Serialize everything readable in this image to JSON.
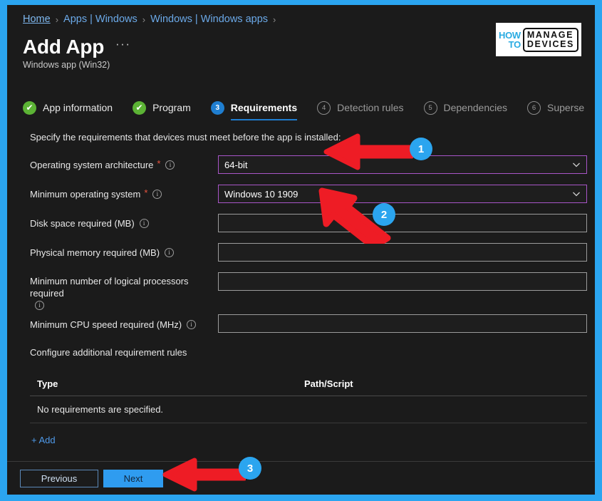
{
  "frame": {
    "accent_color": "#2ba5f0",
    "panel_bg": "#1b1b1b"
  },
  "breadcrumb": {
    "items": [
      {
        "label": "Home"
      },
      {
        "label": "Apps | Windows"
      },
      {
        "label": "Windows | Windows apps"
      }
    ],
    "separator": "›"
  },
  "header": {
    "title": "Add App",
    "ellipsis": "···",
    "subtitle": "Windows app (Win32)"
  },
  "logo": {
    "how": "HOW",
    "to": "TO",
    "manage": "MANAGE",
    "devices": "DEVICES"
  },
  "steps": [
    {
      "badge": "✔",
      "label": "App information",
      "state": "done"
    },
    {
      "badge": "✔",
      "label": "Program",
      "state": "done"
    },
    {
      "badge": "3",
      "label": "Requirements",
      "state": "active"
    },
    {
      "badge": "4",
      "label": "Detection rules",
      "state": "todo"
    },
    {
      "badge": "5",
      "label": "Dependencies",
      "state": "todo"
    },
    {
      "badge": "6",
      "label": "Superse",
      "state": "todo"
    }
  ],
  "form": {
    "intro": "Specify the requirements that devices must meet before the app is installed:",
    "required_marker": "*",
    "info_glyph": "i",
    "fields": [
      {
        "label": "Operating system architecture",
        "required": true,
        "info": true,
        "type": "dropdown",
        "value": "64-bit",
        "border_color": "#a855c8"
      },
      {
        "label": "Minimum operating system",
        "required": true,
        "info": true,
        "type": "dropdown",
        "value": "Windows 10 1909",
        "border_color": "#a855c8"
      },
      {
        "label": "Disk space required (MB)",
        "required": false,
        "info": true,
        "type": "textbox",
        "value": ""
      },
      {
        "label": "Physical memory required (MB)",
        "required": false,
        "info": true,
        "type": "textbox",
        "value": ""
      },
      {
        "label": "Minimum number of logical processors required",
        "required": false,
        "info": true,
        "type": "textbox",
        "value": ""
      },
      {
        "label": "Minimum CPU speed required (MHz)",
        "required": false,
        "info": true,
        "type": "textbox",
        "value": ""
      }
    ]
  },
  "rules": {
    "section_title": "Configure additional requirement rules",
    "columns": [
      "Type",
      "Path/Script"
    ],
    "empty_message": "No requirements are specified.",
    "add_label": "+ Add"
  },
  "footer": {
    "previous_label": "Previous",
    "next_label": "Next"
  },
  "annotations": {
    "color": "#ee1c25",
    "bubble_color": "#2ba5ef",
    "markers": [
      {
        "number": "1"
      },
      {
        "number": "2"
      },
      {
        "number": "3"
      }
    ]
  }
}
